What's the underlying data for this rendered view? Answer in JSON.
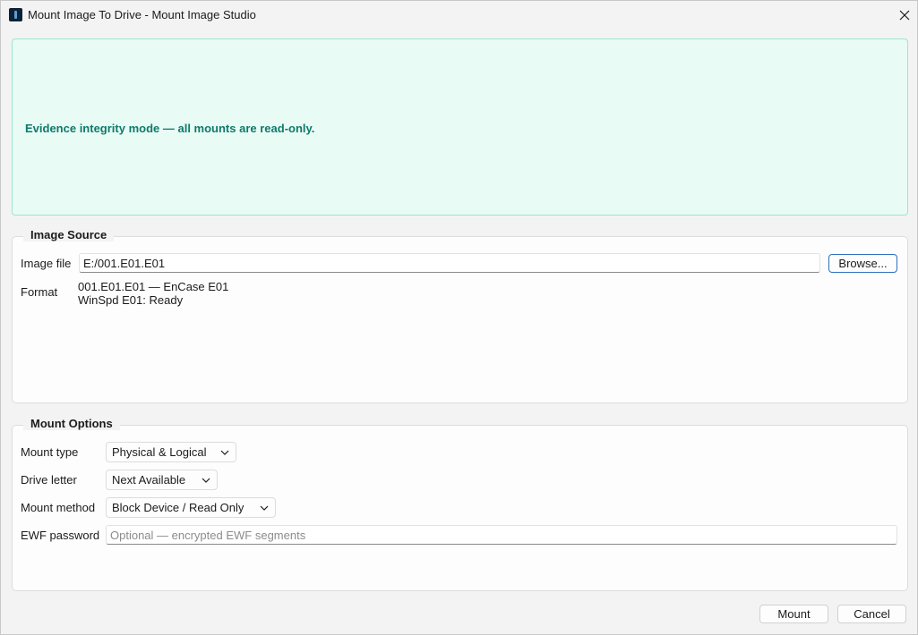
{
  "window": {
    "title": "Mount Image To Drive - Mount Image Studio"
  },
  "banner": {
    "text": "Evidence integrity mode — all mounts are read-only."
  },
  "image_source": {
    "title": "Image Source",
    "image_file_label": "Image file",
    "image_file_value": "E:/001.E01.E01",
    "browse_label": "Browse...",
    "format_label": "Format",
    "format_line1": "001.E01.E01 — EnCase E01",
    "format_line2": "WinSpd E01: Ready"
  },
  "mount_options": {
    "title": "Mount Options",
    "mount_type_label": "Mount type",
    "mount_type_value": "Physical & Logical",
    "drive_letter_label": "Drive letter",
    "drive_letter_value": "Next Available",
    "mount_method_label": "Mount method",
    "mount_method_value": "Block Device / Read Only",
    "ewf_password_label": "EWF password",
    "ewf_password_placeholder": "Optional — encrypted EWF segments"
  },
  "footer": {
    "mount_label": "Mount",
    "cancel_label": "Cancel"
  },
  "colors": {
    "banner_bg": "#e8fbf4",
    "banner_border": "#9fe6cd",
    "banner_text": "#0f7a6b",
    "accent": "#2f6fbd"
  }
}
